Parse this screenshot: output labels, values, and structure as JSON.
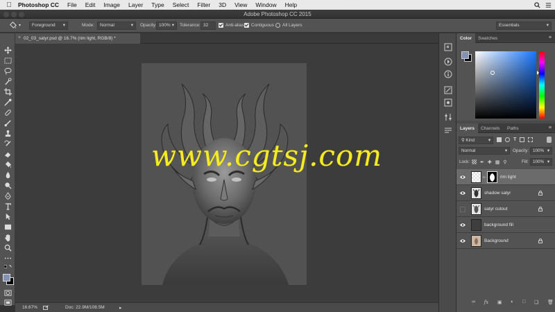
{
  "menubar": {
    "app_name": "Photoshop CC",
    "items": [
      "File",
      "Edit",
      "Image",
      "Layer",
      "Type",
      "Select",
      "Filter",
      "3D",
      "View",
      "Window",
      "Help"
    ]
  },
  "window": {
    "title": "Adobe Photoshop CC 2015"
  },
  "options": {
    "fill_source": "Foreground",
    "mode_label": "Mode:",
    "mode_value": "Normal",
    "opacity_label": "Opacity:",
    "opacity_value": "100%",
    "tolerance_label": "Tolerance:",
    "tolerance_value": "32",
    "antialias_label": "Anti-alias",
    "contiguous_label": "Contiguous",
    "all_layers_label": "All Layers",
    "workspace": "Essentials"
  },
  "document": {
    "tab_title": "02_03_satyr.psd @ 16.7% (rim light, RGB/8) *",
    "zoom": "16.67%",
    "doc_size": "Doc: 22.9M/108.5M"
  },
  "watermark": "www.cgtsj.com",
  "color_panel": {
    "tabs": [
      "Color",
      "Swatches"
    ],
    "foreground": "#8391b4",
    "background": "#000000"
  },
  "layers_panel": {
    "tabs": [
      "Layers",
      "Channels",
      "Paths"
    ],
    "filter_kind": "Kind",
    "blend_mode": "Normal",
    "opacity_label": "Opacity:",
    "opacity_value": "100%",
    "lock_label": "Lock:",
    "fill_label": "Fill:",
    "fill_value": "100%",
    "layers": [
      {
        "name": "rim light"
      },
      {
        "name": "shadow satyr"
      },
      {
        "name": "satyr cutout"
      },
      {
        "name": "background fill"
      },
      {
        "name": "Background"
      }
    ]
  },
  "colors": {
    "panel": "#535353",
    "menubar": "#e9e9e9",
    "watermark": "#f4ea26",
    "selection": "#6b6b6b"
  }
}
